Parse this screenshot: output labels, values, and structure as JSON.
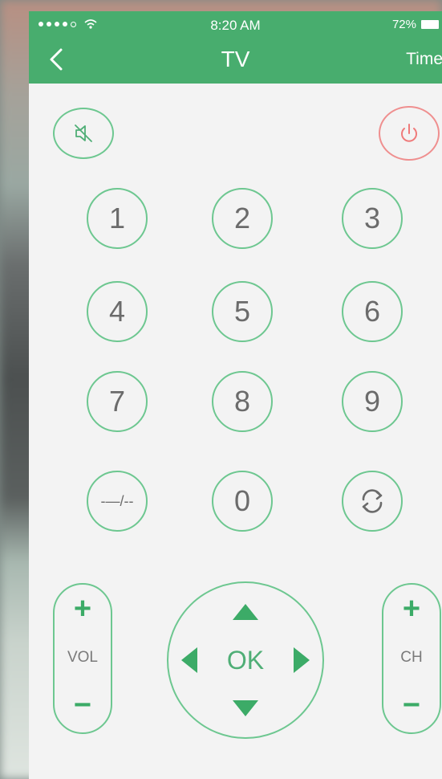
{
  "status": {
    "time": "8:20 AM",
    "battery": "72%"
  },
  "header": {
    "title": "TV",
    "right_action": "Timer"
  },
  "keypad": {
    "digits": [
      "1",
      "2",
      "3",
      "4",
      "5",
      "6",
      "7",
      "8",
      "9"
    ],
    "dash_label": "-—/--",
    "zero_label": "0"
  },
  "volume": {
    "plus": "+",
    "label": "VOL",
    "minus": "−"
  },
  "channel": {
    "plus": "+",
    "label": "CH",
    "minus": "−"
  },
  "dpad": {
    "ok_label": "OK"
  },
  "colors": {
    "accent": "#48ad6e",
    "ring": "#6dc790",
    "power": "#ef8f8f",
    "background": "#f3f3f3"
  }
}
